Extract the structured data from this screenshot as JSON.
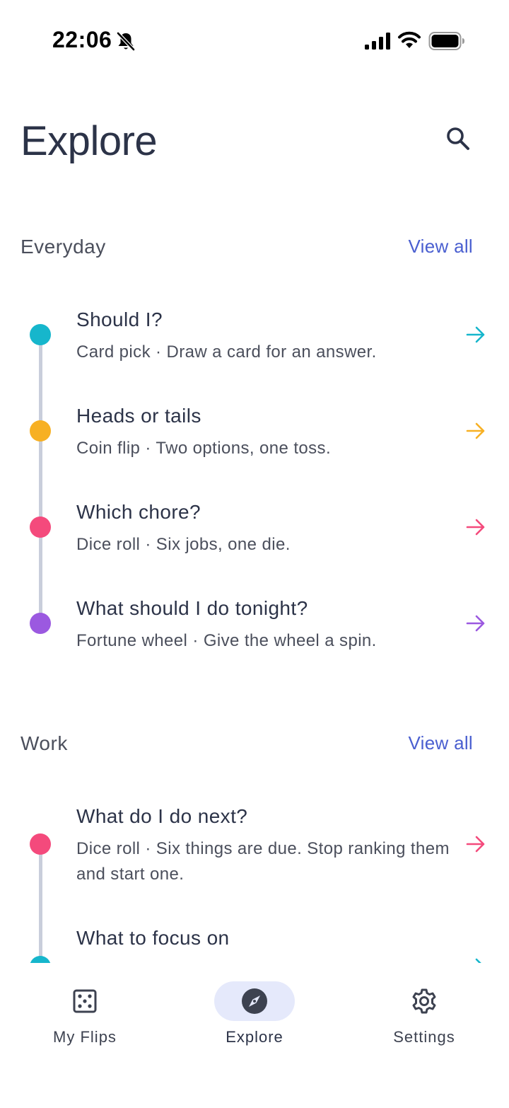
{
  "status_bar": {
    "time": "22:06",
    "icons": [
      "bell-slash-icon",
      "signal-icon",
      "wifi-icon",
      "battery-icon"
    ]
  },
  "header": {
    "title": "Explore",
    "search_icon": "search-icon"
  },
  "sections": [
    {
      "title": "Everyday",
      "view_all": "View all",
      "items": [
        {
          "title": "Should I?",
          "description": "Card pick · Draw a card for an answer.",
          "color": "#16b6cc"
        },
        {
          "title": "Heads or tails",
          "description": "Coin flip · Two options, one toss.",
          "color": "#f7b023"
        },
        {
          "title": "Which chore?",
          "description": "Dice roll · Six jobs, one die.",
          "color": "#f44a7c"
        },
        {
          "title": "What should I do tonight?",
          "description": "Fortune wheel · Give the wheel a spin.",
          "color": "#9b59e0"
        }
      ]
    },
    {
      "title": "Work",
      "view_all": "View all",
      "items": [
        {
          "title": "What do I do next?",
          "description": "Dice roll · Six things are due. Stop ranking them and start one.",
          "color": "#f44a7c"
        },
        {
          "title": "What to focus on",
          "description": "",
          "color": "#16b6cc"
        }
      ]
    }
  ],
  "bottom_nav": {
    "items": [
      {
        "label": "My Flips",
        "icon": "dice-icon",
        "active": false
      },
      {
        "label": "Explore",
        "icon": "compass-icon",
        "active": true
      },
      {
        "label": "Settings",
        "icon": "gear-icon",
        "active": false
      }
    ],
    "active_color": "#e5e9fb"
  }
}
